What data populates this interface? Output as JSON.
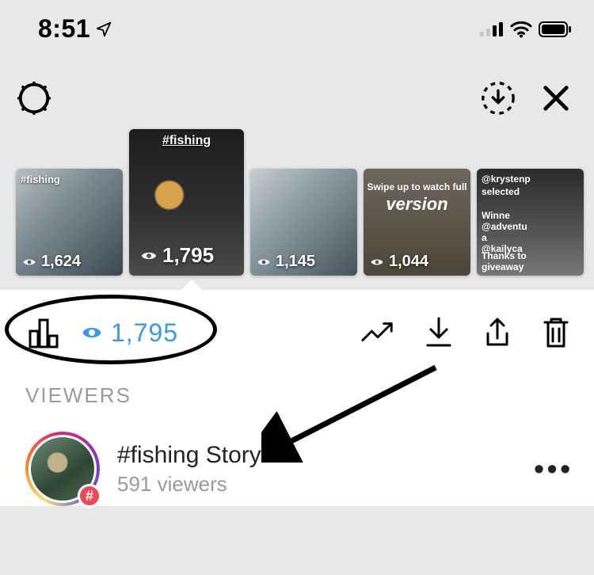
{
  "status": {
    "time": "8:51"
  },
  "storyHeader": {},
  "reel": {
    "thumbs": [
      {
        "tag": "#fishing",
        "views": "1,624"
      },
      {
        "tag": "#fishing",
        "views": "1,795"
      },
      {
        "tag": "",
        "views": "1,145"
      },
      {
        "promoLine1": "Swipe up to watch full",
        "promoLine2": "version",
        "views": "1,044"
      },
      {
        "lines": [
          "@krystenp",
          "selected",
          "Winne",
          "@adventu",
          "a",
          "@kailyca",
          "Thanks to",
          "giveaway"
        ]
      }
    ]
  },
  "stats": {
    "viewCount": "1,795"
  },
  "viewers": {
    "sectionTitle": "VIEWERS",
    "entry": {
      "hashSymbol": "#",
      "title": "#fishing Story",
      "subtitle": "591 viewers",
      "more": "•••"
    }
  }
}
